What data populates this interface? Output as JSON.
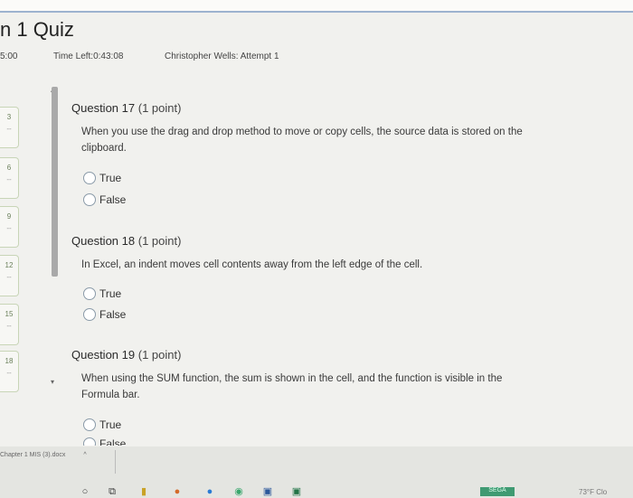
{
  "header": {
    "title": "n 1 Quiz",
    "timer_partial": "5:00",
    "time_left": "Time Left:0:43:08",
    "attempt": "Christopher Wells: Attempt 1"
  },
  "left_rail": {
    "chips": [
      {
        "num": "3",
        "dash": "--"
      },
      {
        "num": "6",
        "dash": "--"
      },
      {
        "num": "9",
        "dash": "--"
      },
      {
        "num": "12",
        "dash": "--"
      },
      {
        "num": "15",
        "dash": "--"
      },
      {
        "num": "18",
        "dash": "--"
      }
    ]
  },
  "questions": [
    {
      "heading": "Question 17",
      "points": "(1 point)",
      "text": "When you use the drag and drop method to move or copy cells, the source data is stored on the clipboard.",
      "options": [
        "True",
        "False"
      ]
    },
    {
      "heading": "Question 18",
      "points": "(1 point)",
      "text": "In Excel, an indent moves cell contents away from the left edge of the cell.",
      "options": [
        "True",
        "False"
      ]
    },
    {
      "heading": "Question 19",
      "points": "(1 point)",
      "text": "When using the SUM function, the sum is shown in the cell, and the function is visible in the Formula bar.",
      "options": [
        "True",
        "False"
      ]
    }
  ],
  "downloads": {
    "file": "Chapter 1 MIS (3).docx",
    "chevron": "^"
  },
  "taskbar": {
    "tray_text": "SEGA",
    "weather": "73°F Clo"
  },
  "colors": {
    "accent": "#9db3cf",
    "chip_border": "#c8d5b7",
    "scroll": "#a9a9a9",
    "tray": "#3f9a72"
  }
}
